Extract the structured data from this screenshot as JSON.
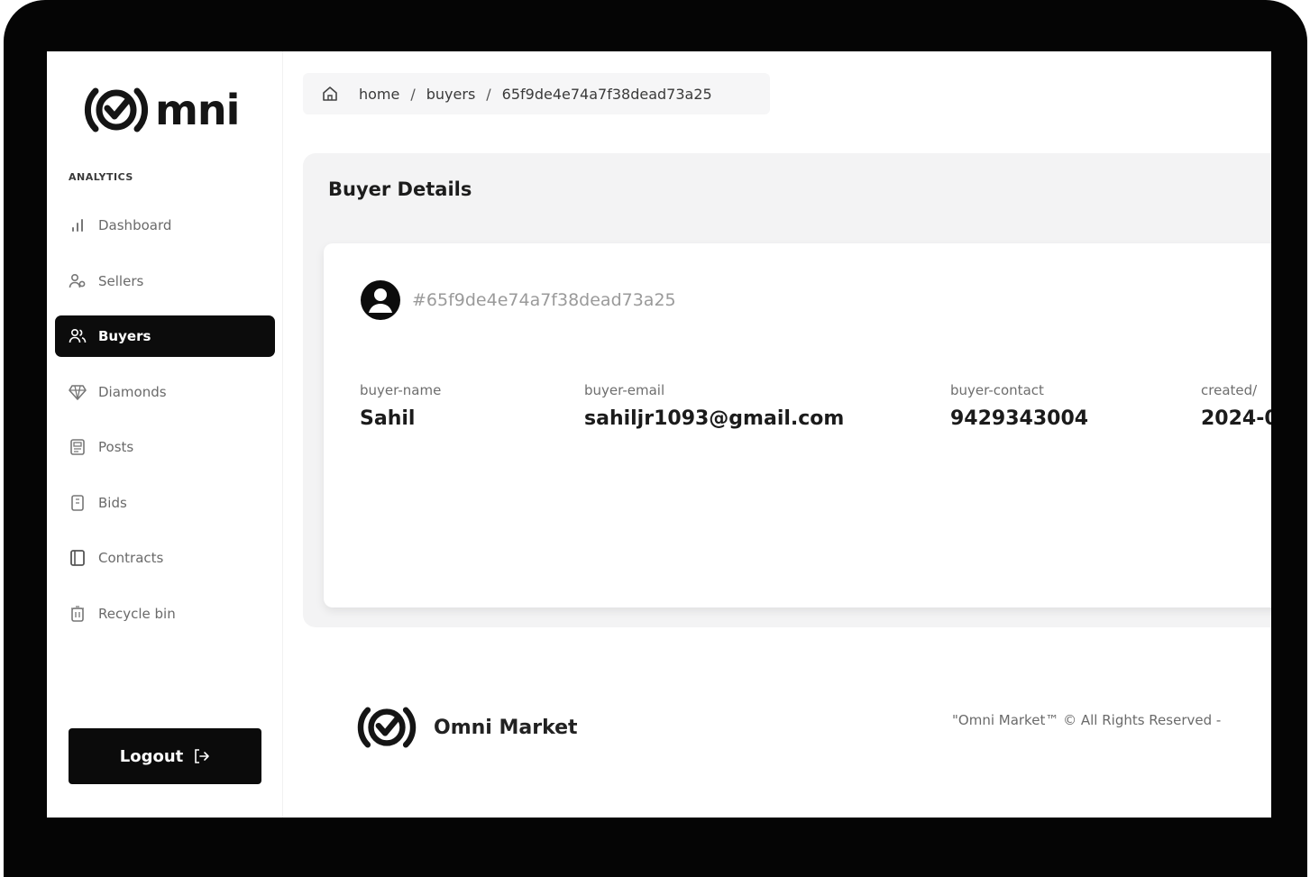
{
  "brand": {
    "logo_text": "mni",
    "footer_name": "Omni Market",
    "copyright": "\"Omni Market™ © All Rights Reserved -"
  },
  "sidebar": {
    "section_label": "ANALYTICS",
    "items": [
      {
        "label": "Dashboard",
        "icon": "bar-chart-icon",
        "active": false
      },
      {
        "label": "Sellers",
        "icon": "user-icon",
        "active": false
      },
      {
        "label": "Buyers",
        "icon": "users-icon",
        "active": true
      },
      {
        "label": "Diamonds",
        "icon": "diamond-icon",
        "active": false
      },
      {
        "label": "Posts",
        "icon": "posts-icon",
        "active": false
      },
      {
        "label": "Bids",
        "icon": "bids-icon",
        "active": false
      },
      {
        "label": "Contracts",
        "icon": "contract-icon",
        "active": false
      },
      {
        "label": "Recycle bin",
        "icon": "trash-icon",
        "active": false
      }
    ],
    "logout_label": "Logout"
  },
  "breadcrumb": {
    "home": "home",
    "section": "buyers",
    "current": "65f9de4e74a7f38dead73a25"
  },
  "details": {
    "title": "Buyer Details",
    "buyer_id": "#65f9de4e74a7f38dead73a25",
    "fields": [
      {
        "label": "buyer-name",
        "value": "Sahil"
      },
      {
        "label": "buyer-email",
        "value": "sahiljr1093@gmail.com"
      },
      {
        "label": "buyer-contact",
        "value": "9429343004"
      },
      {
        "label": "created/",
        "value": "2024-0"
      }
    ]
  },
  "colors": {
    "accent": "#0c0c0c",
    "panel_bg": "#f3f3f4",
    "muted_text": "#9a9a9a"
  }
}
